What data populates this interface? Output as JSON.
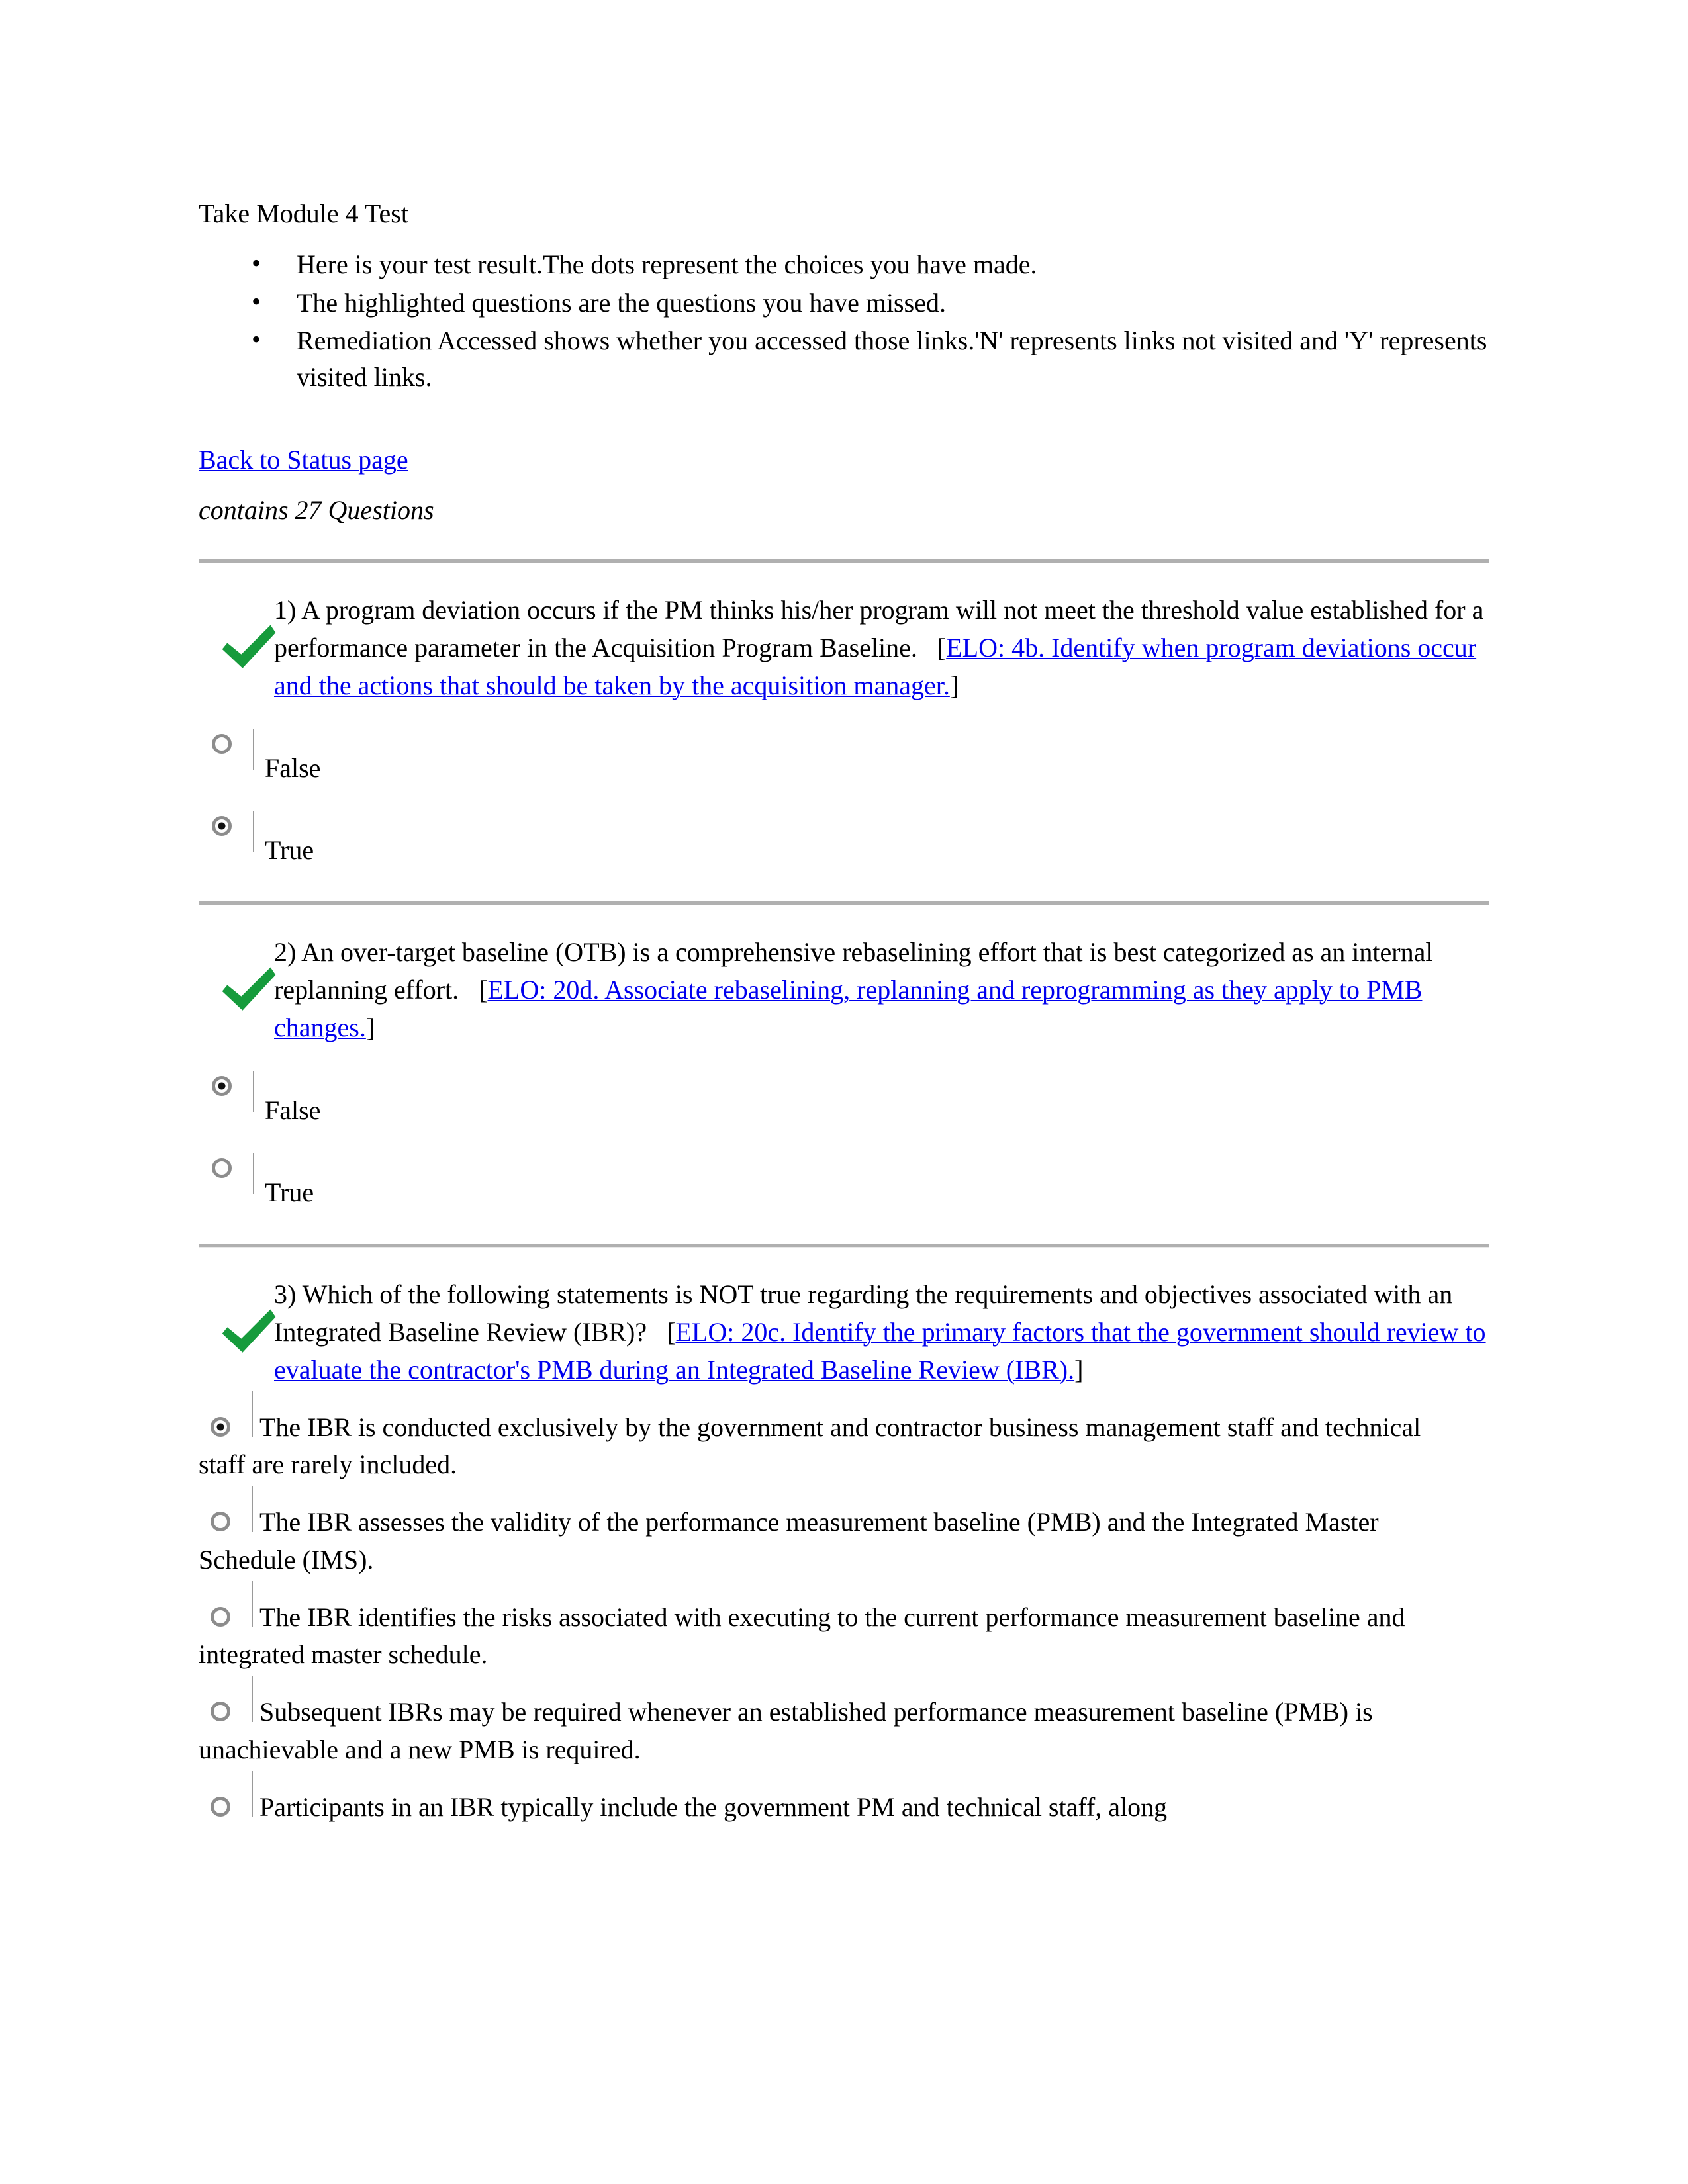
{
  "document": {
    "title": "Take Module 4 Test",
    "intro_bullets": [
      "Here is your test result.The dots represent the choices you have made.",
      "The highlighted questions are the questions you have missed.",
      "Remediation Accessed shows whether you accessed those links.'N' represents links not visited and 'Y' represents visited links."
    ],
    "back_link": "Back to Status page",
    "contains_line": "contains 27 Questions",
    "link_color": "#0000ee",
    "check_color": "#169b3c",
    "rule_color": "#b0b0b0"
  },
  "questions": [
    {
      "number": "1)",
      "stem": "1) A program deviation occurs if the PM thinks his/her program will not meet the threshold value established for a performance parameter in the Acquisition Program Baseline.",
      "elo_open": "[",
      "elo_link": "ELO: 4b. Identify when program deviations occur and the actions that should be taken by the acquisition manager.",
      "elo_close": "]",
      "marked_correct": true,
      "options": [
        {
          "label": "False",
          "selected": false
        },
        {
          "label": "True",
          "selected": true
        }
      ]
    },
    {
      "number": "2)",
      "stem": "2) An over-target baseline (OTB) is a comprehensive rebaselining effort that is best categorized as an internal replanning effort.",
      "elo_open": "[",
      "elo_link": "ELO: 20d. Associate rebaselining, replanning and reprogramming as they apply to PMB changes.",
      "elo_close": "]",
      "marked_correct": true,
      "options": [
        {
          "label": "False",
          "selected": true
        },
        {
          "label": "True",
          "selected": false
        }
      ]
    },
    {
      "number": "3)",
      "stem": "3) Which of the following statements is NOT true regarding the requirements and objectives associated with an Integrated Baseline Review (IBR)?",
      "elo_open": "[",
      "elo_link": "ELO: 20c. Identify the primary factors that the government should review to evaluate the contractor's PMB during an Integrated Baseline Review (IBR).",
      "elo_close": "]",
      "marked_correct": true,
      "options": [
        {
          "label": "The IBR is conducted exclusively by the government and contractor business management staff and technical staff are rarely included.",
          "selected": true
        },
        {
          "label": "The IBR assesses the validity of the performance measurement baseline (PMB) and the Integrated Master Schedule (IMS).",
          "selected": false
        },
        {
          "label": "The IBR identifies the risks associated with executing to the current performance measurement baseline and integrated master schedule.",
          "selected": false
        },
        {
          "label": "Subsequent IBRs may be required whenever an established performance measurement baseline (PMB) is unachievable and a new PMB is required.",
          "selected": false
        },
        {
          "label": "Participants in an IBR typically include the government PM and technical staff, along",
          "selected": false
        }
      ]
    }
  ]
}
